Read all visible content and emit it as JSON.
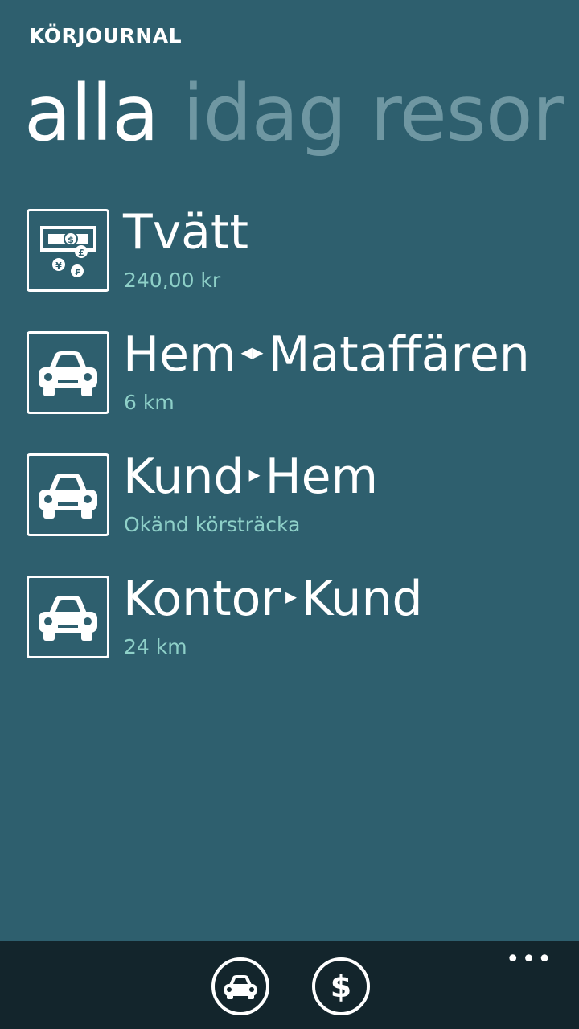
{
  "app": {
    "title": "KÖRJOURNAL"
  },
  "pivot": {
    "tabs": [
      {
        "label": "alla",
        "active": true
      },
      {
        "label": "idag",
        "active": false
      },
      {
        "label": "resor",
        "active": false
      }
    ]
  },
  "entries": [
    {
      "icon": "money-icon",
      "title": "Tvätt",
      "subtitle": "240,00 kr"
    },
    {
      "icon": "car-icon",
      "from": "Hem",
      "arrow": "◂▸",
      "to": "Mataffären",
      "subtitle": "6 km"
    },
    {
      "icon": "car-icon",
      "from": "Kund",
      "arrow": "▸",
      "to": "Hem",
      "subtitle": "Okänd körsträcka"
    },
    {
      "icon": "car-icon",
      "from": "Kontor",
      "arrow": "▸",
      "to": "Kund",
      "subtitle": "24 km"
    }
  ],
  "appbar": {
    "buttons": [
      {
        "icon": "car-icon"
      },
      {
        "icon": "dollar-icon"
      }
    ],
    "more": "•••"
  },
  "colors": {
    "background": "#2e5f6e",
    "accent_subtitle": "#8ed0c8",
    "inactive_pivot": "#6f97a2",
    "appbar": "#13252c"
  }
}
